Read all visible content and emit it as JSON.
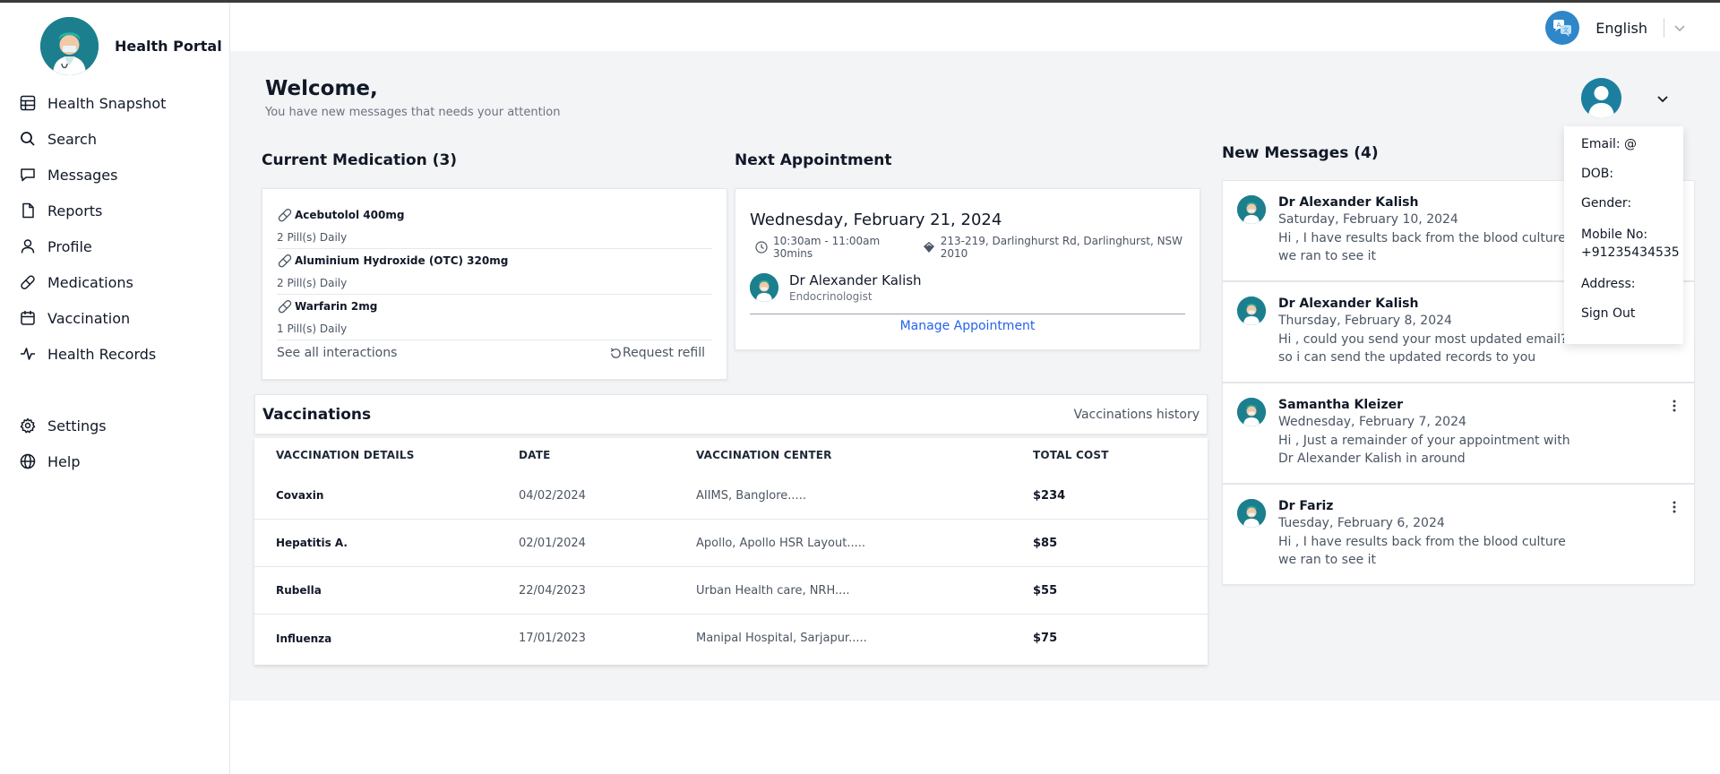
{
  "app": {
    "brand_name": "Health Portal"
  },
  "sidebar": {
    "items": [
      {
        "label": "Health Snapshot",
        "icon": "table-icon"
      },
      {
        "label": "Search",
        "icon": "search-icon"
      },
      {
        "label": "Messages",
        "icon": "message-icon"
      },
      {
        "label": "Reports",
        "icon": "file-icon"
      },
      {
        "label": "Profile",
        "icon": "user-icon"
      },
      {
        "label": "Medications",
        "icon": "pill-icon"
      },
      {
        "label": "Vaccination",
        "icon": "calendar-icon"
      },
      {
        "label": "Health Records",
        "icon": "activity-icon"
      }
    ],
    "bottom_items": [
      {
        "label": "Settings",
        "icon": "gear-icon"
      },
      {
        "label": "Help",
        "icon": "globe-icon"
      }
    ]
  },
  "topbar": {
    "language": "English"
  },
  "header": {
    "welcome": "Welcome,",
    "subtitle": "You have new messages that needs your attention"
  },
  "medication": {
    "title": "Current Medication (3)",
    "items": [
      {
        "name": "Acebutolol 400mg",
        "dose": "2 Pill(s) Daily"
      },
      {
        "name": "Aluminium Hydroxide (OTC) 320mg",
        "dose": "2 Pill(s) Daily"
      },
      {
        "name": "Warfarin 2mg",
        "dose": "1 Pill(s) Daily"
      }
    ],
    "see_all": "See all interactions",
    "refill": "Request refill"
  },
  "appointment": {
    "title": "Next Appointment",
    "date": "Wednesday, February 21, 2024",
    "time": "10:30am - 11:00am 30mins",
    "location": "213-219, Darlinghurst Rd, Darlinghurst, NSW 2010",
    "doctor": "Dr Alexander Kalish",
    "specialty": "Endocrinologist",
    "manage": "Manage Appointment"
  },
  "vaccinations": {
    "title": "Vaccinations",
    "history": "Vaccinations history",
    "columns": [
      "VACCINATION DETAILS",
      "DATE",
      "VACCINATION CENTER",
      "TOTAL COST"
    ],
    "rows": [
      [
        "Covaxin",
        "04/02/2024",
        "AIIMS, Banglore.....",
        "$234"
      ],
      [
        "Hepatitis A.",
        "02/01/2024",
        "Apollo, Apollo HSR Layout.....",
        "$85"
      ],
      [
        "Rubella",
        "22/04/2023",
        "Urban Health care, NRH....",
        "$55"
      ],
      [
        "Influenza",
        "17/01/2023",
        "Manipal Hospital, Sarjapur.....",
        "$75"
      ]
    ]
  },
  "messages": {
    "title": "New Messages (4)",
    "items": [
      {
        "from": "Dr Alexander Kalish",
        "date": "Saturday, February 10, 2024",
        "text": "Hi , I have results back from the blood culture we ran to see it"
      },
      {
        "from": "Dr Alexander Kalish",
        "date": "Thursday, February 8, 2024",
        "text": "Hi , could you send your most updated email? so i can send the updated records to you"
      },
      {
        "from": "Samantha Kleizer",
        "date": "Wednesday, February 7, 2024",
        "text": "Hi , Just a remainder of your appointment with Dr Alexander Kalish in around"
      },
      {
        "from": "Dr Fariz",
        "date": "Tuesday, February 6, 2024",
        "text": "Hi , I have results back from the blood culture we ran to see it"
      }
    ]
  },
  "profile_menu": {
    "email": "Email: @",
    "dob": "DOB:",
    "gender": "Gender:",
    "mobile_label": "Mobile No:",
    "mobile_value": "+91235434535",
    "address": "Address:",
    "sign_out": "Sign Out"
  },
  "colors": {
    "brand_teal": "#1b7f8e",
    "link_blue": "#2563eb",
    "language_icon": "#2f86c9"
  }
}
